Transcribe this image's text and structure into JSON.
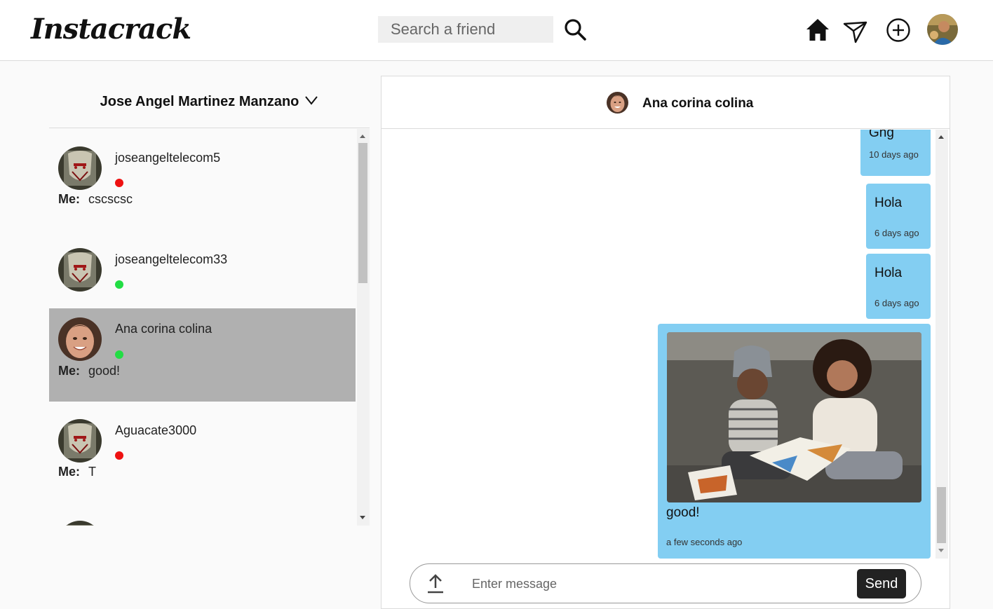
{
  "header": {
    "logo": "Instacrack",
    "search_placeholder": "Search a friend"
  },
  "icons": {
    "search": "search-icon",
    "home": "home-icon",
    "messages": "paper-plane-icon",
    "create": "plus-circle-icon",
    "profile": "avatar"
  },
  "sidebar": {
    "account_name": "Jose Angel Martinez Manzano",
    "me_label": "Me:",
    "conversations": [
      {
        "username": "joseangeltelecom5",
        "online": false,
        "last_message": "cscscsc",
        "active": false
      },
      {
        "username": "joseangeltelecom33",
        "online": true,
        "last_message": "",
        "active": false
      },
      {
        "username": "Ana corina colina",
        "online": true,
        "last_message": "good!",
        "active": true
      },
      {
        "username": "Aguacate3000",
        "online": false,
        "last_message": "T",
        "active": false
      }
    ]
  },
  "chat": {
    "contact_name": "Ana corina colina",
    "messages": [
      {
        "text": "Ghg",
        "time": "10 days ago"
      },
      {
        "text": "Hola",
        "time": "6 days ago"
      },
      {
        "text": "Hola",
        "time": "6 days ago"
      },
      {
        "text": "good!",
        "time": "a few seconds ago",
        "has_image": true
      }
    ],
    "input_placeholder": "Enter message",
    "send_label": "Send"
  },
  "colors": {
    "bubble": "#83cef2",
    "online": "#22dd44",
    "offline": "#ee1111",
    "active_row": "#b0b0b0"
  }
}
